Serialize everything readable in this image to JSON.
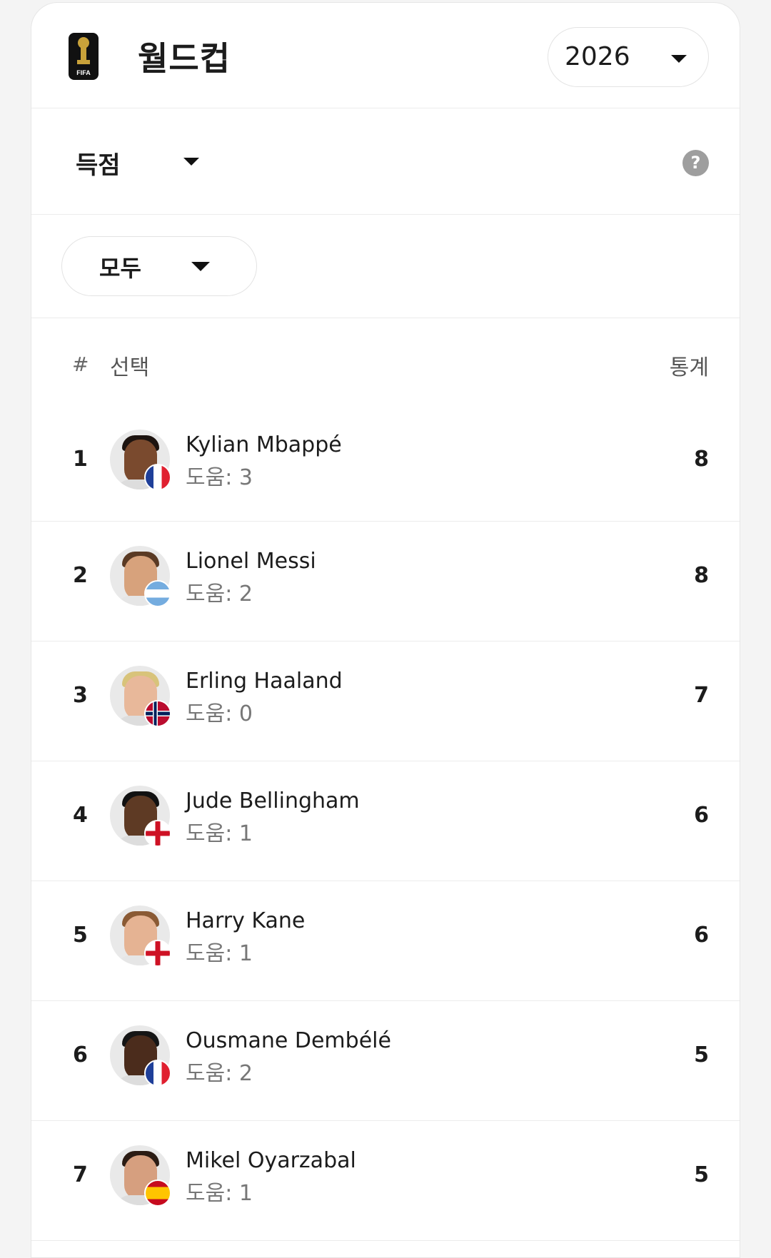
{
  "header": {
    "title": "월드컵",
    "logo_text": "FIFA",
    "year": "2026"
  },
  "stat_type": {
    "label": "득점",
    "help_icon": "?"
  },
  "filter": {
    "label": "모두"
  },
  "table": {
    "col_rank": "#",
    "col_player": "선택",
    "col_stat": "통계"
  },
  "players": [
    {
      "rank": "1",
      "name": "Kylian Mbappé",
      "assist": "도움: 3",
      "value": "8",
      "flag": "france"
    },
    {
      "rank": "2",
      "name": "Lionel Messi",
      "assist": "도움: 2",
      "value": "8",
      "flag": "argentina"
    },
    {
      "rank": "3",
      "name": "Erling Haaland",
      "assist": "도움: 0",
      "value": "7",
      "flag": "norway"
    },
    {
      "rank": "4",
      "name": "Jude Bellingham",
      "assist": "도움: 1",
      "value": "6",
      "flag": "england"
    },
    {
      "rank": "5",
      "name": "Harry Kane",
      "assist": "도움: 1",
      "value": "6",
      "flag": "england"
    },
    {
      "rank": "6",
      "name": "Ousmane Dembélé",
      "assist": "도움: 2",
      "value": "5",
      "flag": "france"
    },
    {
      "rank": "7",
      "name": "Mikel Oyarzabal",
      "assist": "도움: 1",
      "value": "5",
      "flag": "spain"
    }
  ]
}
